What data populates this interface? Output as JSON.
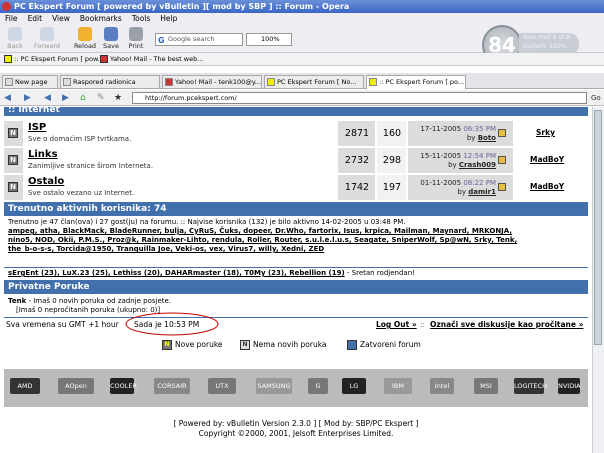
{
  "window": {
    "title": "PC Ekspert Forum [ powered by vBulletin ][ mod by SBP ] :: Forum - Opera"
  },
  "menu": [
    "File",
    "Edit",
    "View",
    "Bookmarks",
    "Tools",
    "Help"
  ],
  "toolbar": {
    "back": "Back",
    "forward": "Forward",
    "reload": "Reload",
    "save": "Save",
    "print": "Print",
    "search_placeholder": "Google search",
    "zoom": "100%"
  },
  "clock": {
    "value": "84",
    "line1": "New mail 8 of 8",
    "line2": "System: 100%"
  },
  "bookmarks": [
    ":: PC Ekspert Forum [ pow...",
    "Yahoo! Mail - The best web..."
  ],
  "tabs": [
    "New page",
    "Raspored radionica",
    "Yahoo! Mail - tenk100@y...",
    "PC Ekspert Forum [ No...",
    ":: PC Ekspert Forum [ po..."
  ],
  "address": "http://forum.pcekspert.com/",
  "category": {
    "title": ":: Internet"
  },
  "forums": [
    {
      "icon": "N",
      "name": "ISP",
      "desc": "Sve o domaćim ISP tvrtkama.",
      "threads": "2871",
      "posts": "160",
      "date": "17-11-2005",
      "time": "06:35 PM",
      "by": "by",
      "user": "Boto",
      "mod": "Srky"
    },
    {
      "icon": "N",
      "name": "Links",
      "desc": "Zanimljive stranice širom Interneta.",
      "threads": "2732",
      "posts": "298",
      "date": "15-11-2005",
      "time": "12:54 PM",
      "by": "by",
      "user": "Crash009",
      "mod": "MadBoY"
    },
    {
      "icon": "N",
      "name": "Ostalo",
      "desc": "Sve ostalo vezano uz Internet.",
      "threads": "1742",
      "posts": "197",
      "date": "01-11-2005",
      "time": "08:22 PM",
      "by": "by",
      "user": "damir1",
      "mod": "MadBoY"
    }
  ],
  "active": {
    "title": "Trenutno aktivnih korisnika: 74",
    "summary": "Trenutno je 47 član(ova) i 27 gost(ju) na forumu. :: Najvise korisnika (132) je bilo aktivno 14-02-2005 u 03:48 PM.",
    "line1": "ampeg, atha, BlackMack, BladeRunner, bulja, CyRuS, Čuks, dopeer, Dr.Who, fartorix, Isus, krpica, Mailman, Maynard, MRKONJA,",
    "line2": "nino5, NOD, Okii, P.M.S., Proz@k, Rainmaker-Lihto, rendula, Roller, Router, s.u.l.e.l.u.s, Seagate, SniperWolf, Sp@wN, Srky, Tenk,",
    "line3": "the_b-o-s-s, Torcida@1950, Tranquilla Joe, Veki-os, vex, Virus7, willy, Xedni, ZED",
    "birthday_list": "sErgEnt (23), LuX.23 (25), Lethiss (20), DAHARmaster (18), T0My (23), Rebellion (19)",
    "birthday_text": " - Sretan rodjendan!"
  },
  "private": {
    "title": "Privatne Poruke",
    "user": "Tenk",
    "line1": " - Imaš 0 novih poruka od zadnje posjete.",
    "line2": "[Imaš 0 nepročitanih poruka (ukupno: 0)]"
  },
  "time": {
    "tz": "Sva vremena su GMT +1 hour",
    "now": "Sada je 10:53 PM",
    "logout": "Log Out »",
    "mark": "Označi sve diskusije kao pročitane »"
  },
  "legend": {
    "new": "Nove poruke",
    "none": "Nema novih poruka",
    "closed": "Zatvoreni forum"
  },
  "logos": [
    "AMD",
    "AOpen",
    "COOLER",
    "CORSAIR",
    "UTX",
    "SAMSUNG",
    "G",
    "LG",
    "IBM",
    "Intel",
    "MSI",
    "LOGITECH",
    "NVIDIA"
  ],
  "footer": {
    "line1": "[ Powered by: vBulletin Version 2.3.0 ] [ Mod by: SBP/PC Ekspert ]",
    "line2": "Copyright ©2000, 2001, Jelsoft Enterprises Limited."
  },
  "colors": {
    "header_blue": "#4170ad",
    "row_gray": "#dcdcdc",
    "logo_bg": "#bbbbbb",
    "circle_red": "#c00000"
  }
}
